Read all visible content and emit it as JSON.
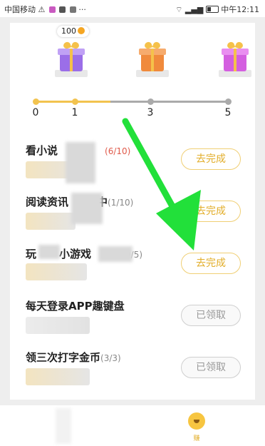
{
  "status_bar": {
    "carrier": "中国移动",
    "icons": [
      "warning-icon",
      "app-icon",
      "app-icon",
      "app-icon",
      "more-icon"
    ],
    "right_icons": [
      "wifi-icon",
      "signal-4g-icon",
      "battery-icon"
    ],
    "clock": "中午12:11"
  },
  "coins": {
    "value": "100",
    "icon": "coin-icon"
  },
  "gifts": [
    {
      "color": "#9b6ee8",
      "lid": "#c0a1f5"
    },
    {
      "color": "#f08a3c",
      "lid": "#f6ab6d"
    },
    {
      "color": "#d45fe0",
      "lid": "#e98ef0"
    }
  ],
  "progress": {
    "nodes": [
      "0",
      "1",
      "3",
      "5"
    ],
    "completed": 2
  },
  "tasks": [
    {
      "title": "看小说",
      "progress": "(6/10)",
      "button": "去完成",
      "state": "todo"
    },
    {
      "title": "阅读资讯",
      "title_suffix": "中",
      "progress": "(1/10)",
      "button": "去完成",
      "state": "todo"
    },
    {
      "title": "玩",
      "title_suffix": "小游戏",
      "progress": "0/5)",
      "button": "去完成",
      "state": "todo"
    },
    {
      "title": "每天登录APP趣键盘",
      "progress": "",
      "button": "已领取",
      "state": "done"
    },
    {
      "title": "领三次打字金币",
      "progress": "(3/3)",
      "button": "已领取",
      "state": "done"
    }
  ],
  "annotation": {
    "type": "arrow",
    "color": "#22e03a"
  },
  "bottom_nav": {
    "active_icon": "smile-coin-icon",
    "active_label": "赚"
  }
}
